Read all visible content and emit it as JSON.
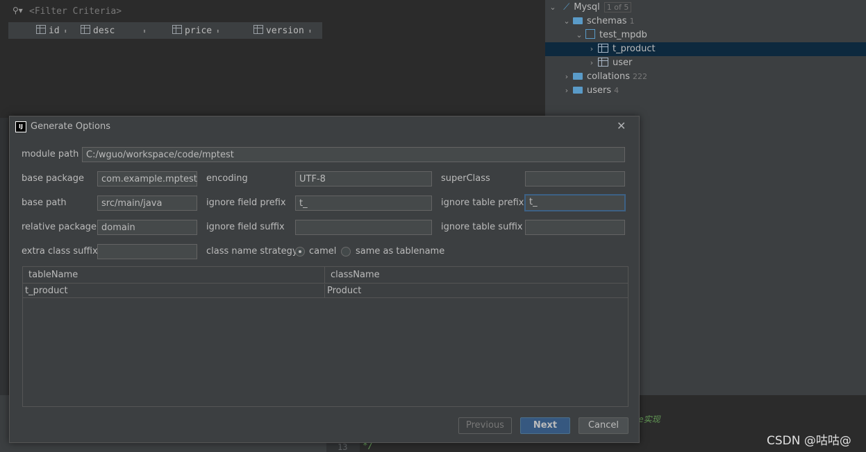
{
  "filter": {
    "placeholder": "<Filter Criteria>"
  },
  "grid_columns": [
    "id",
    "desc",
    "price",
    "version"
  ],
  "tree": {
    "root": {
      "label": "Mysql",
      "badge": "1 of 5"
    },
    "schemas": {
      "label": "schemas",
      "count": "1"
    },
    "db": {
      "label": "test_mpdb"
    },
    "tables": [
      "t_product",
      "user"
    ],
    "collations": {
      "label": "collations",
      "count": "222"
    },
    "users": {
      "label": "users",
      "count": "4"
    }
  },
  "editor": {
    "comment": "ice实现",
    "comment_close": "*/",
    "line_number": "13"
  },
  "watermark": "CSDN @咕咕@",
  "dialog": {
    "title": "Generate Options",
    "module_path": {
      "label": "module path",
      "value": "C:/wguo/workspace/code/mptest"
    },
    "base_package": {
      "label": "base package",
      "value": "com.example.mptest"
    },
    "encoding": {
      "label": "encoding",
      "value": "UTF-8"
    },
    "super_class": {
      "label": "superClass",
      "value": ""
    },
    "base_path": {
      "label": "base path",
      "value": "src/main/java"
    },
    "ignore_field_prefix": {
      "label": "ignore field prefix",
      "value": "t_"
    },
    "ignore_table_prefix": {
      "label": "ignore table prefix",
      "value": "t_"
    },
    "relative_package": {
      "label": "relative package",
      "value": "domain"
    },
    "ignore_field_suffix": {
      "label": "ignore field suffix",
      "value": ""
    },
    "ignore_table_suffix": {
      "label": "ignore table suffix",
      "value": ""
    },
    "extra_class_suffix": {
      "label": "extra class suffix",
      "value": ""
    },
    "class_name_strategy": {
      "label": "class name strategy",
      "options": [
        "camel",
        "same as tablename"
      ],
      "selected": "camel"
    },
    "table": {
      "headers": [
        "tableName",
        "className"
      ],
      "rows": [
        [
          "t_product",
          "Product"
        ]
      ]
    },
    "buttons": {
      "previous": "Previous",
      "next": "Next",
      "cancel": "Cancel"
    }
  }
}
